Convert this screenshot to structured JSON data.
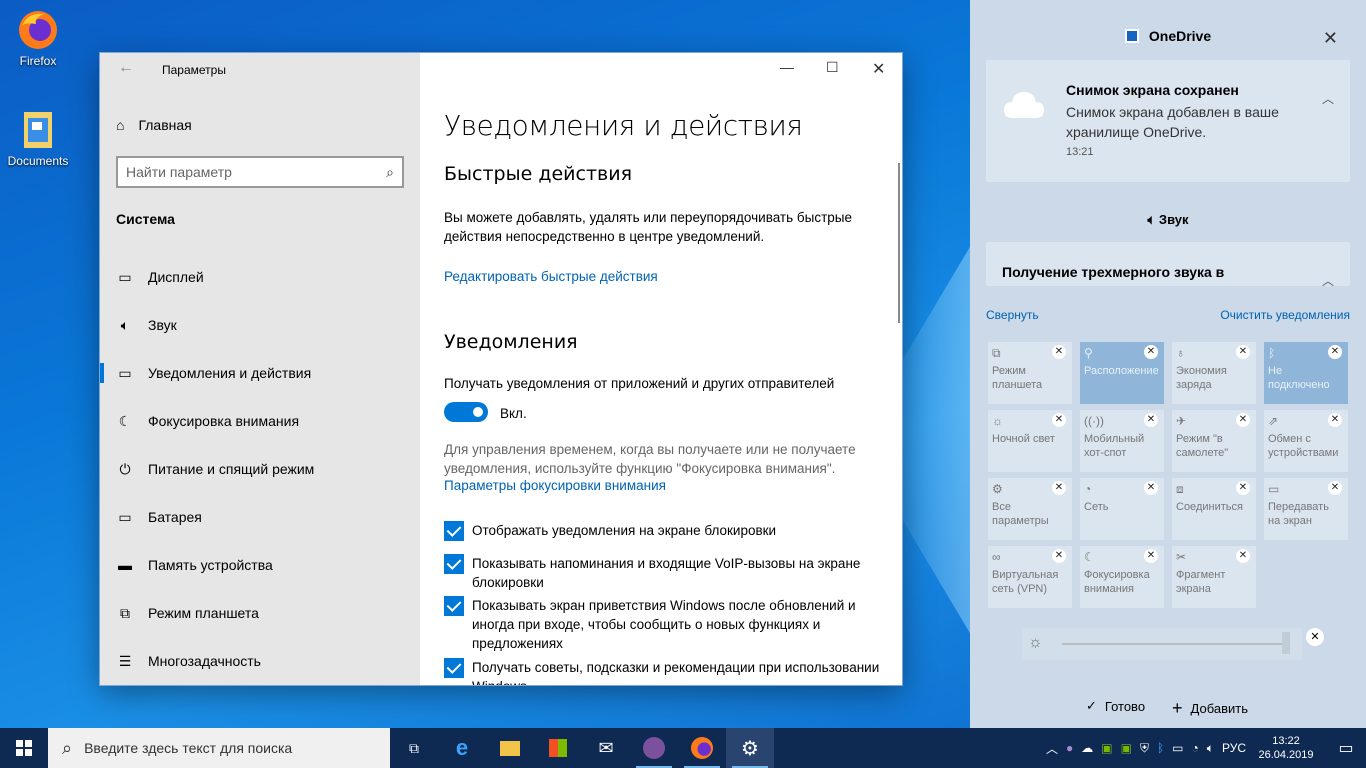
{
  "desktop": {
    "icons": [
      {
        "label": "Firefox"
      },
      {
        "label": "Documents"
      }
    ]
  },
  "window": {
    "title": "Параметры",
    "home": "Главная",
    "search_placeholder": "Найти параметр",
    "section": "Система",
    "nav": [
      {
        "label": "Дисплей",
        "icon": "display-icon"
      },
      {
        "label": "Звук",
        "icon": "sound-icon"
      },
      {
        "label": "Уведомления и действия",
        "icon": "notifications-icon",
        "active": true
      },
      {
        "label": "Фокусировка внимания",
        "icon": "moon-icon"
      },
      {
        "label": "Питание и спящий режим",
        "icon": "power-icon"
      },
      {
        "label": "Батарея",
        "icon": "battery-icon"
      },
      {
        "label": "Память устройства",
        "icon": "storage-icon"
      },
      {
        "label": "Режим планшета",
        "icon": "tablet-icon"
      },
      {
        "label": "Многозадачность",
        "icon": "multitask-icon"
      }
    ]
  },
  "page": {
    "title": "Уведомления и действия",
    "quick_h": "Быстрые действия",
    "quick_p": "Вы можете добавлять, удалять или переупорядочивать быстрые действия непосредственно в центре уведомлений.",
    "quick_link": "Редактировать быстрые действия",
    "notif_h": "Уведомления",
    "notif_label": "Получать уведомления от приложений и других отправителей",
    "toggle_state": "Вкл.",
    "focus_p": "Для управления временем, когда вы получаете или не получаете уведомления, используйте функцию \"Фокусировка внимания\".",
    "focus_link": "Параметры фокусировки внимания",
    "checkboxes": [
      {
        "label": "Отображать уведомления на экране блокировки",
        "checked": true
      },
      {
        "label": "Показывать напоминания и входящие VoIP-вызовы на экране блокировки",
        "checked": true
      },
      {
        "label": "Показывать экран приветствия Windows после обновлений и иногда при входе, чтобы сообщить о новых функциях и предложениях",
        "checked": true
      },
      {
        "label": "Получать советы, подсказки и рекомендации при использовании Windows",
        "checked": true
      }
    ]
  },
  "action_center": {
    "app": "OneDrive",
    "notif_title": "Снимок экрана сохранен",
    "notif_body": "Снимок экрана добавлен в ваше хранилище OneDrive.",
    "notif_time": "13:21",
    "sound_app": "Звук",
    "sound_notif": "Получение трехмерного звука в",
    "collapse": "Свернуть",
    "clear": "Очистить уведомления",
    "tiles": [
      {
        "label": "Режим планшета",
        "on": false
      },
      {
        "label": "Расположение",
        "on": true
      },
      {
        "label": "Экономия заряда",
        "on": false
      },
      {
        "label": "Не подключено",
        "on": true
      },
      {
        "label": "Ночной свет",
        "on": false
      },
      {
        "label": "Мобильный хот-спот",
        "on": false
      },
      {
        "label": "Режим \"в самолете\"",
        "on": false
      },
      {
        "label": "Обмен с устройствами",
        "on": false
      },
      {
        "label": "Все параметры",
        "on": false
      },
      {
        "label": "Сеть",
        "on": false
      },
      {
        "label": "Соединиться",
        "on": false
      },
      {
        "label": "Передавать на экран",
        "on": false
      },
      {
        "label": "Виртуальная сеть (VPN)",
        "on": false
      },
      {
        "label": "Фокусировка внимания",
        "on": false
      },
      {
        "label": "Фрагмент экрана",
        "on": false
      }
    ],
    "done": "Готово",
    "add": "Добавить"
  },
  "taskbar": {
    "search_placeholder": "Введите здесь текст для поиска",
    "lang": "РУС",
    "time": "13:22",
    "date": "26.04.2019"
  },
  "colors": {
    "accent": "#0078d7",
    "taskbar": "#0f2a52"
  }
}
